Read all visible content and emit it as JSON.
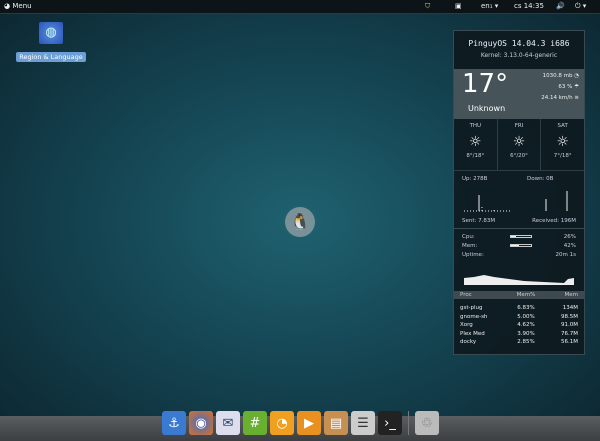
{
  "topbar": {
    "menu_label": "Menu",
    "keyboard": "en₁ ▾",
    "clock": "cs 14:35",
    "power": "⏻ ▾",
    "volume": "🔊"
  },
  "desktop": {
    "icon_label": "Region & Language"
  },
  "widget": {
    "os": "PinguyOS 14.04.3 i686",
    "kernel": "Kernel: 3.13.0-64-generic",
    "weather": {
      "temp": "17°",
      "condition": "Unknown",
      "pressure": "1030.8 mb",
      "humidity": "63 %",
      "wind": "24.14 km/h",
      "forecast": [
        {
          "day": "THU",
          "range": "8°/18°"
        },
        {
          "day": "FRI",
          "range": "6°/20°"
        },
        {
          "day": "SAT",
          "range": "7°/18°"
        }
      ]
    },
    "network": {
      "up": "Up: 278B",
      "down": "Down: 0B",
      "sent": "Sent: 7.83M",
      "received": "Received: 196M"
    },
    "system": {
      "cpu_label": "Cpu:",
      "cpu": "26%",
      "cpu_frac": 0.26,
      "mem_label": "Mem:",
      "mem": "42%",
      "mem_frac": 0.42,
      "uptime_label": "Uptime:",
      "uptime": "20m 1s"
    },
    "proc_headers": [
      "Proc",
      "Mem%",
      "Mem"
    ],
    "procs": [
      [
        "gst-plug",
        "6.83%",
        "134M"
      ],
      [
        "gnome-sh",
        "5.00%",
        "98.5M"
      ],
      [
        "Xorg",
        "4.62%",
        "91.0M"
      ],
      [
        "Plex Med",
        "3.90%",
        "76.7M"
      ],
      [
        "docky",
        "2.85%",
        "56.1M"
      ]
    ]
  },
  "dock": [
    "anchor",
    "firefox",
    "thunderbird",
    "hexchat",
    "orange",
    "video",
    "files",
    "mixer",
    "terminal",
    "trash"
  ]
}
